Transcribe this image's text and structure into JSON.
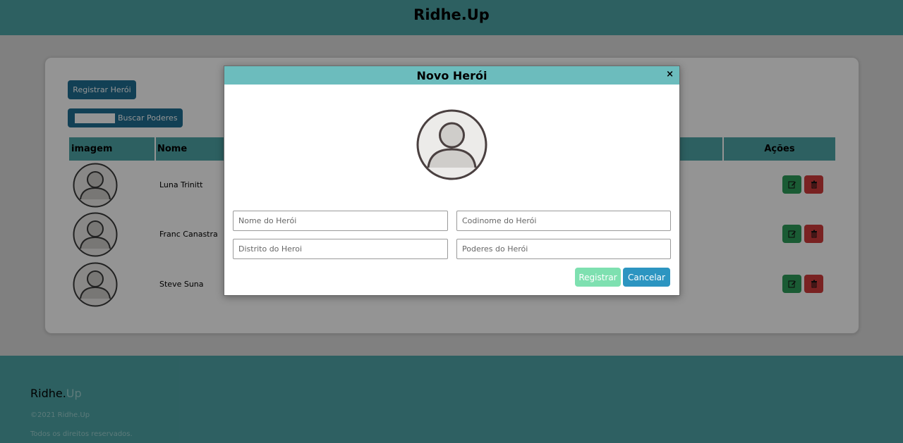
{
  "header": {
    "brand": "Ridhe.Up"
  },
  "toolbar": {
    "register_label": "Registrar Herói",
    "search_label": "Buscar Poderes"
  },
  "table": {
    "headers": {
      "image": "imagem",
      "name": "Nome",
      "actions": "Ações"
    },
    "rows": [
      {
        "name": "Luna Trinitt"
      },
      {
        "name": "Franc Canastra"
      },
      {
        "name": "Steve Suna"
      }
    ],
    "edit_icon": "edit-icon",
    "delete_icon": "trash-icon"
  },
  "modal": {
    "title": "Novo Herói",
    "close_label": "×",
    "fields": {
      "name_placeholder": "Nome do Herói",
      "codename_placeholder": "Codinome do Herói",
      "district_placeholder": "Distrito do Heroi",
      "powers_placeholder": "Poderes do Herói"
    },
    "register_label": "Registrar",
    "cancel_label": "Cancelar"
  },
  "footer": {
    "brand_main": "Ridhe.",
    "brand_accent": "Up",
    "copyright": "©2021 Ridhe.Up",
    "rights": "Todos os direitos reservados."
  },
  "colors": {
    "teal": "#4fa6a8",
    "modal_header": "#6cbcbd",
    "primary": "#1f6f93",
    "edit": "#2e9e5a",
    "delete": "#d03c3c",
    "register": "#7ee0b0",
    "cancel": "#2c95c1"
  }
}
